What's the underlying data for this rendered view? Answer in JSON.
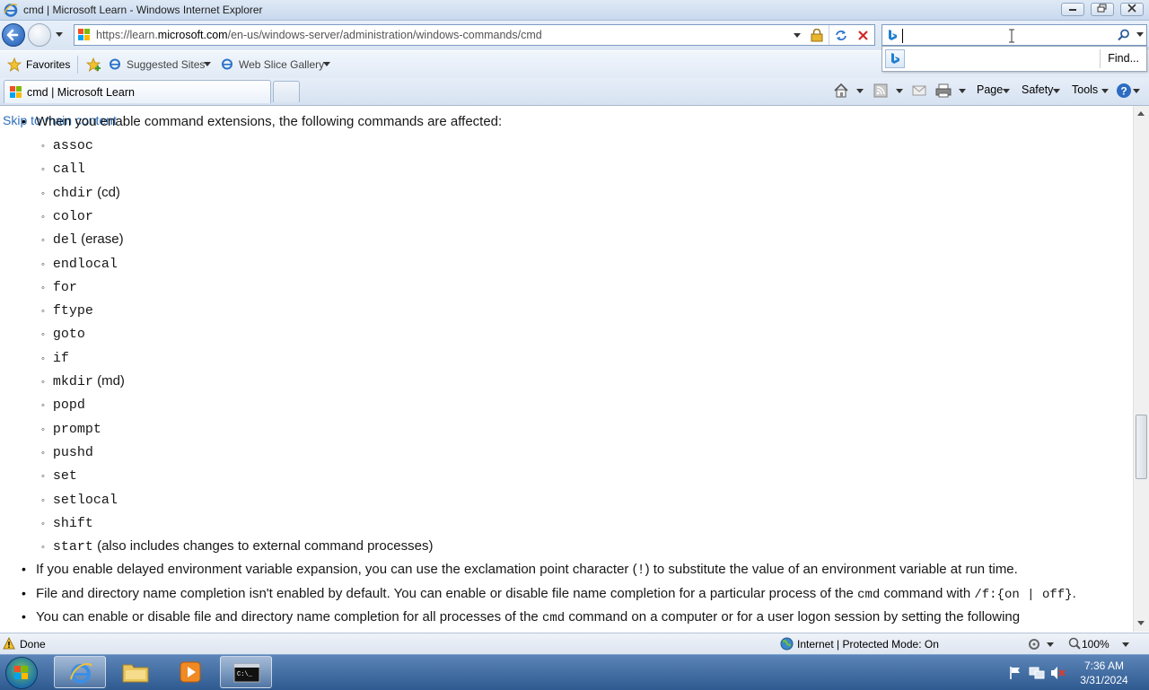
{
  "window": {
    "title": "cmd | Microsoft Learn - Windows Internet Explorer"
  },
  "address_bar": {
    "url_prefix": "https://learn.",
    "url_domain": "microsoft.com",
    "url_path": "/en-us/windows-server/administration/windows-commands/cmd"
  },
  "search": {
    "value": "",
    "find_label": "Find..."
  },
  "favorites_bar": {
    "favorites_label": "Favorites",
    "items": [
      {
        "label": "Suggested Sites"
      },
      {
        "label": "Web Slice Gallery"
      }
    ]
  },
  "tabs": [
    {
      "label": "cmd | Microsoft Learn"
    }
  ],
  "command_bar": {
    "page_label": "Page",
    "safety_label": "Safety",
    "tools_label": "Tools"
  },
  "content": {
    "skip_link": "Skip to main content",
    "intro": "When you enable command extensions, the following commands are affected:",
    "commands": [
      {
        "code": "assoc",
        "note": ""
      },
      {
        "code": "call",
        "note": ""
      },
      {
        "code": "chdir",
        "note": " (cd)"
      },
      {
        "code": "color",
        "note": ""
      },
      {
        "code": "del",
        "note": " (erase)"
      },
      {
        "code": "endlocal",
        "note": ""
      },
      {
        "code": "for",
        "note": ""
      },
      {
        "code": "ftype",
        "note": ""
      },
      {
        "code": "goto",
        "note": ""
      },
      {
        "code": "if",
        "note": ""
      },
      {
        "code": "mkdir",
        "note": " (md)"
      },
      {
        "code": "popd",
        "note": ""
      },
      {
        "code": "prompt",
        "note": ""
      },
      {
        "code": "pushd",
        "note": ""
      },
      {
        "code": "set",
        "note": ""
      },
      {
        "code": "setlocal",
        "note": ""
      },
      {
        "code": "shift",
        "note": ""
      },
      {
        "code": "start",
        "note": " (also includes changes to external command processes)"
      }
    ],
    "bullet_delayed_pre": "If you enable delayed environment variable expansion, you can use the exclamation point character (",
    "bullet_delayed_code": "!",
    "bullet_delayed_post": ") to substitute the value of an environment variable at run time.",
    "bullet_completion_pre": "File and directory name completion isn't enabled by default. You can enable or disable file name completion for a particular process of the ",
    "bullet_completion_code1": "cmd",
    "bullet_completion_mid": " command with ",
    "bullet_completion_code2": "/f:{on | off}",
    "bullet_completion_post": ".",
    "bullet_all_pre": "You can enable or disable file and directory name completion for all processes of the ",
    "bullet_all_code": "cmd",
    "bullet_all_post": " command on a computer or for a user logon session by setting the following"
  },
  "status_bar": {
    "status": "Done",
    "zone": "Internet | Protected Mode: On",
    "zoom": "100%"
  },
  "taskbar": {
    "time": "7:36 AM",
    "date": "3/31/2024"
  }
}
